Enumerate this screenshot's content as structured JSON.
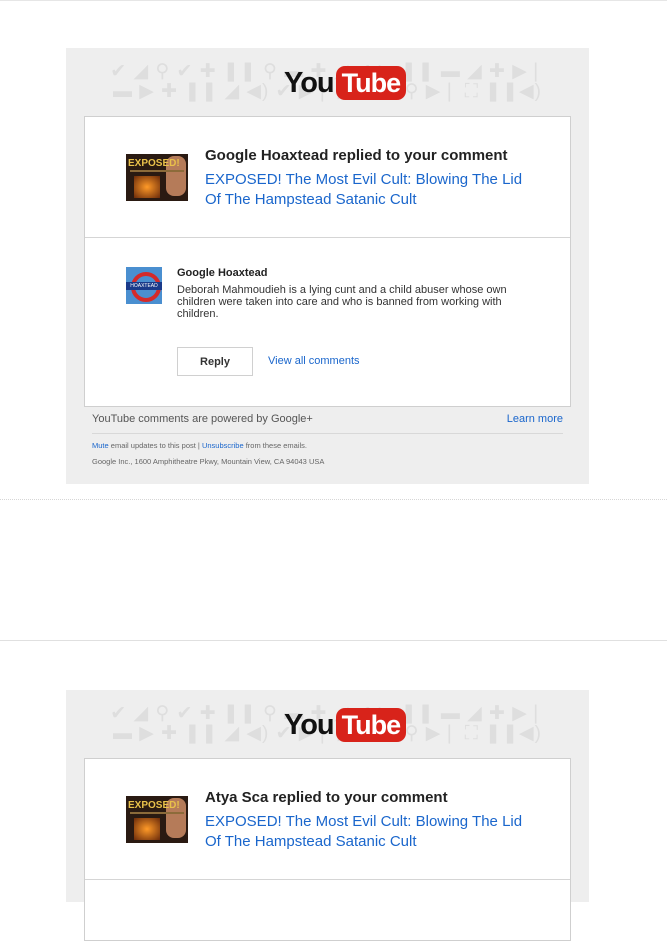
{
  "logo": {
    "you": "You",
    "tube": "Tube"
  },
  "pattern": {
    "row1": "✔ ◢ ⚲ ✔ ✚ ❚❚ ⚲ ▬ ✚ ◢ ✔ ▶ ❚❚ ▬ ◢ ✚ ▶❘",
    "row2": "▬ ▶ ✚ ❚❚ ◢ ◀) ✔ ▶❘ ▶ ✚ ◢ ⚲ ▶❘ ⛶ ❚❚◀)"
  },
  "emails": [
    {
      "title": "Google Hoaxtead replied to your comment",
      "video_link": "EXPOSED! The Most Evil Cult: Blowing The Lid Of The Hampstead Satanic Cult",
      "thumb_text": "EXPOSED!",
      "commenter": "Google Hoaxtead",
      "avatar_text": "HOAXTEAD",
      "comment": "Deborah Mahmoudieh is a lying cunt and a child abuser whose own children were taken into care and who is banned from working with children.",
      "reply_label": "Reply",
      "view_all_label": "View all comments",
      "powered_text": "YouTube comments are powered by Google+",
      "learn_more": "Learn more",
      "mute_link": "Mute",
      "mute_text": " email updates to this post | ",
      "unsubscribe_link": "Unsubscribe",
      "unsubscribe_text": " from these emails.",
      "address": "Google Inc., 1600 Amphitheatre Pkwy, Mountain View, CA 94043 USA"
    },
    {
      "title": "Atya Sca replied to your comment",
      "video_link": "EXPOSED! The Most Evil Cult: Blowing The Lid Of The Hampstead Satanic Cult",
      "thumb_text": "EXPOSED!"
    }
  ]
}
